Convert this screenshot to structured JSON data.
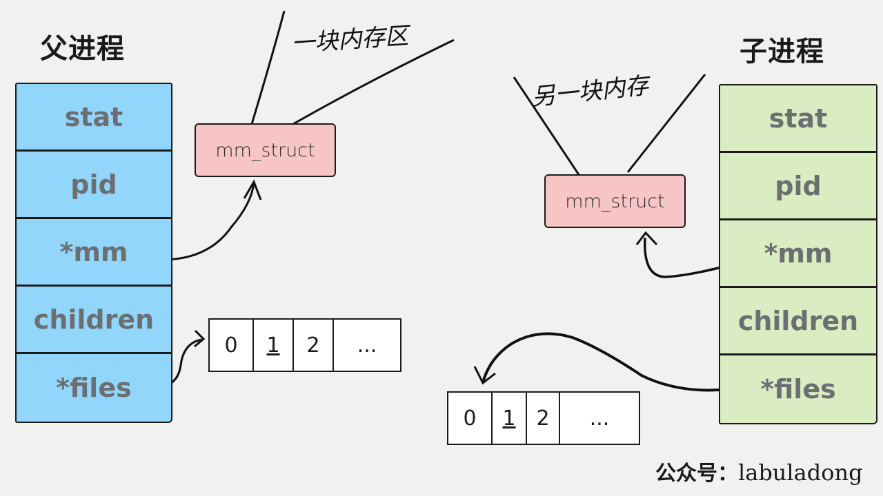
{
  "parent": {
    "title": "父进程",
    "color": "#92d6fb",
    "fields": [
      "stat",
      "pid",
      "*mm",
      "children",
      "*files"
    ],
    "mm_struct_label": "mm_struct",
    "memory_annotation": "一块内存区",
    "fd_table": [
      "0",
      "1",
      "2",
      "..."
    ]
  },
  "child": {
    "title": "子进程",
    "color": "#daecc1",
    "fields": [
      "stat",
      "pid",
      "*mm",
      "children",
      "*files"
    ],
    "mm_struct_label": "mm_struct",
    "memory_annotation": "另一块内存",
    "fd_table": [
      "0",
      "1",
      "2",
      "..."
    ]
  },
  "mm_struct_color": "#f7c5c6",
  "watermark": {
    "prefix": "公众号：",
    "name": "labuladong"
  }
}
